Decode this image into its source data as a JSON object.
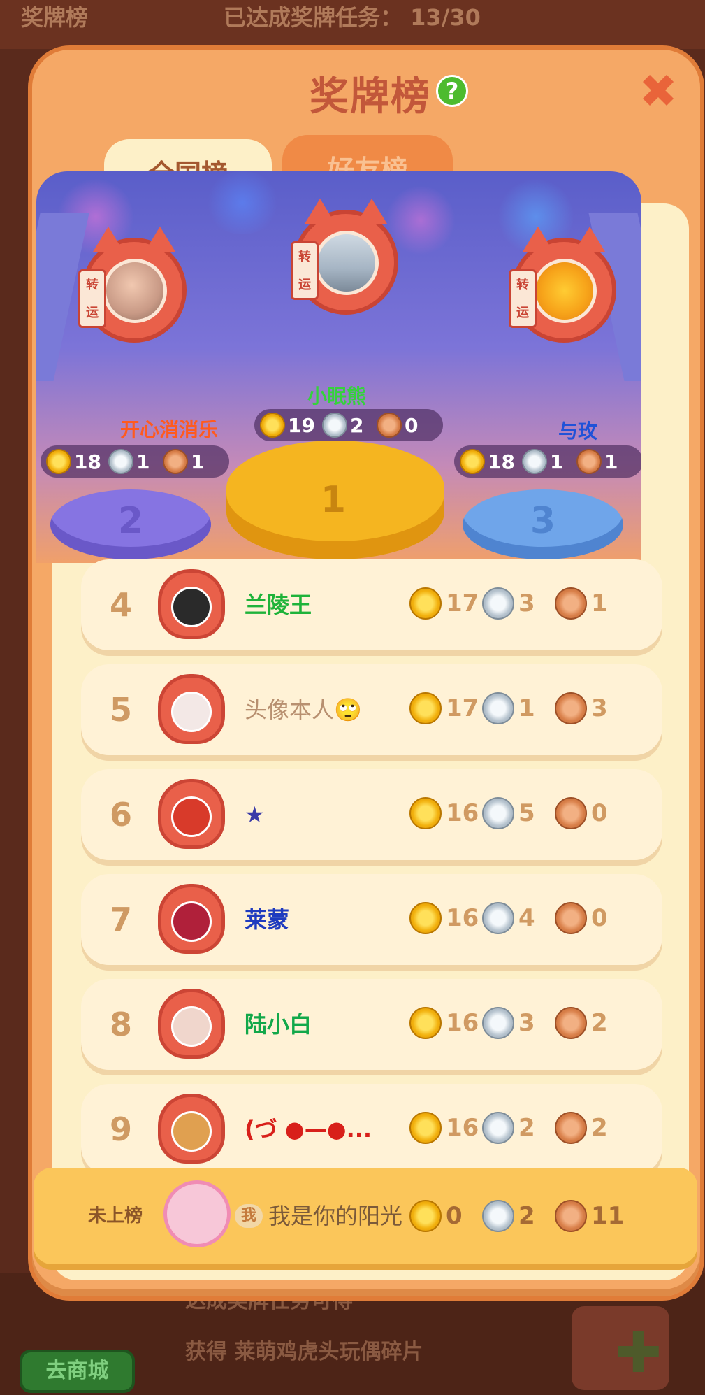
{
  "background": {
    "top_left_label": "奖牌榜",
    "top_progress": "已达成奖牌任务： 13/30",
    "bottom_line1": "达成奖牌任务可得",
    "bottom_line2": "获得 莱萌鸡虎头玩偶碎片",
    "shop_button": "去商城"
  },
  "modal": {
    "title": "奖牌榜",
    "help_symbol": "?",
    "close_symbol": "✖",
    "tabs": [
      {
        "label": "全国榜",
        "active": true
      },
      {
        "label": "好友榜",
        "active": false
      }
    ]
  },
  "podium": {
    "lucky_tag": "转运",
    "first": {
      "rank": "1",
      "name": "小眠熊",
      "gold": "19",
      "silver": "2",
      "bronze": "0"
    },
    "second": {
      "rank": "2",
      "name": "开心消消乐",
      "gold": "18",
      "silver": "1",
      "bronze": "1"
    },
    "third": {
      "rank": "3",
      "name": "与玫",
      "gold": "18",
      "silver": "1",
      "bronze": "1"
    }
  },
  "list": [
    {
      "rank": "4",
      "name": "兰陵王",
      "name_color": "#1fb33a",
      "gold": "17",
      "silver": "3",
      "bronze": "1"
    },
    {
      "rank": "5",
      "name": "头像本人🙄",
      "name_color": "#b89070",
      "gold": "17",
      "silver": "1",
      "bronze": "3"
    },
    {
      "rank": "6",
      "name": "★",
      "name_color": "#3b3ba8",
      "gold": "16",
      "silver": "5",
      "bronze": "0"
    },
    {
      "rank": "7",
      "name": "莱蒙",
      "name_color": "#1f3bbf",
      "gold": "16",
      "silver": "4",
      "bronze": "0"
    },
    {
      "rank": "8",
      "name": "陆小白",
      "name_color": "#12a84a",
      "gold": "16",
      "silver": "3",
      "bronze": "2"
    },
    {
      "rank": "9",
      "name": "(づ ●—●...",
      "name_color": "#d8201a",
      "gold": "16",
      "silver": "2",
      "bronze": "2"
    }
  ],
  "self": {
    "status": "未上榜",
    "me_badge": "我",
    "name": "我是你的阳光",
    "gold": "0",
    "silver": "2",
    "bronze": "11"
  },
  "colors": {
    "modal_bg": "#f5a866",
    "panel_bg": "#fdf0c8",
    "title": "#c2573a",
    "help_green": "#4dbb2f",
    "close_orange": "#e9643a"
  },
  "icons": [
    "help-icon",
    "close-icon",
    "gold-medal-icon",
    "silver-medal-icon",
    "bronze-medal-icon",
    "cat-avatar-frame-icon",
    "tiger-avatar-frame-icon"
  ]
}
